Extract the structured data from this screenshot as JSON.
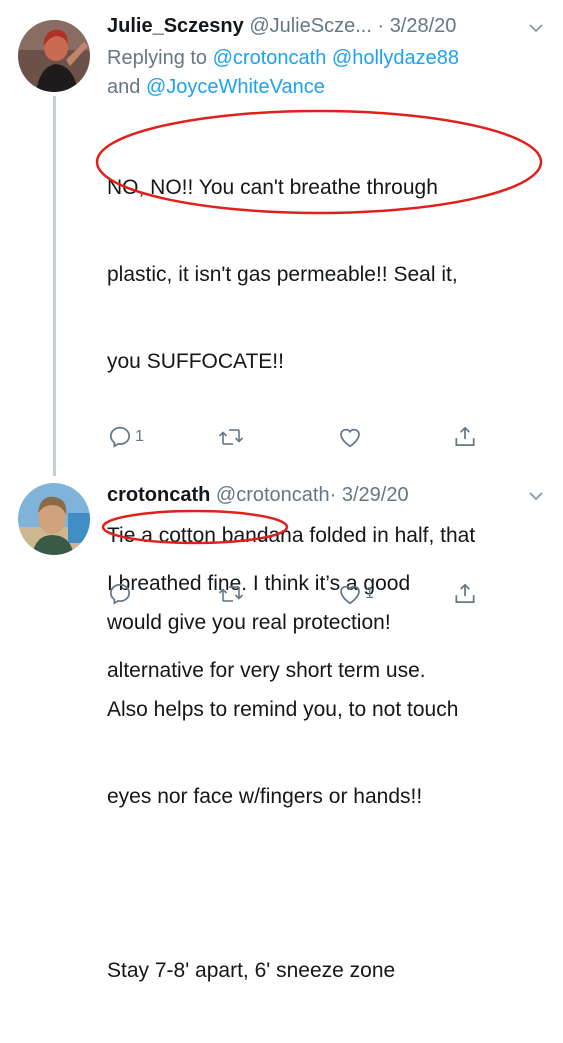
{
  "tweets": [
    {
      "name": "Julie_Sczesny",
      "handle": "@JulieScze...",
      "dot": "·",
      "date": "3/28/20",
      "replying_prefix": "Replying to ",
      "mentions": [
        "@crotoncath",
        "@hollydaze88"
      ],
      "replying_and": "and ",
      "mention_last": "@JoyceWhiteVance",
      "text_lines": [
        "NO, NO!! You can't breathe through",
        "plastic, it isn't gas permeable!! Seal it,",
        "you SUFFOCATE!!",
        "",
        "Tie a cotton bandana folded in half, that",
        "would give you real protection!",
        "Also helps to remind you, to not touch",
        "eyes nor face w/fingers or hands!!",
        "",
        "Stay 7-8' apart, 6' sneeze zone"
      ],
      "reply_count": "1",
      "retweet_count": "",
      "like_count": ""
    },
    {
      "name": "crotoncath",
      "handle": "@crotoncath",
      "dot": "·",
      "date": "3/29/20",
      "text_lines": [
        "I breathed fine. I think it’s a good",
        "alternative for very short term use."
      ],
      "reply_count": "",
      "retweet_count": "",
      "like_count": "1"
    }
  ],
  "annotation_color": "#e0201b",
  "icons": [
    "reply-icon",
    "retweet-icon",
    "like-icon",
    "share-icon",
    "chevron-down-icon"
  ]
}
